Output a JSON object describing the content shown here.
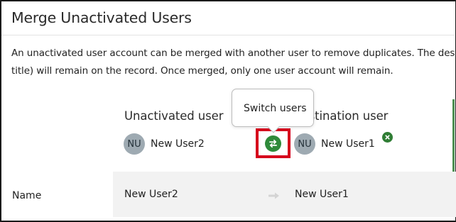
{
  "dialog": {
    "title": "Merge Unactivated Users",
    "description_line1": "An unactivated user account can be merged with another user to remove duplicates. The desti",
    "description_line2": "title) will remain on the record. Once merged, only one user account will remain."
  },
  "columns": {
    "left_title": "Unactivated user",
    "right_title": "Destination user"
  },
  "users": {
    "unactivated": {
      "initials": "NU",
      "name": "New User2"
    },
    "destination": {
      "initials": "NU",
      "name": "New User1"
    }
  },
  "tooltip": {
    "text": "Switch users"
  },
  "fields": [
    {
      "label": "Name",
      "from": "New User2",
      "to": "New User1"
    }
  ],
  "icons": {
    "switch": "switch-arrows-icon",
    "remove": "close-icon",
    "merge_arrow": "arrow-right-icon"
  },
  "colors": {
    "accent_green": "#2f8a3a",
    "highlight_red": "#d6001c",
    "avatar_bg": "#9eaab2"
  }
}
